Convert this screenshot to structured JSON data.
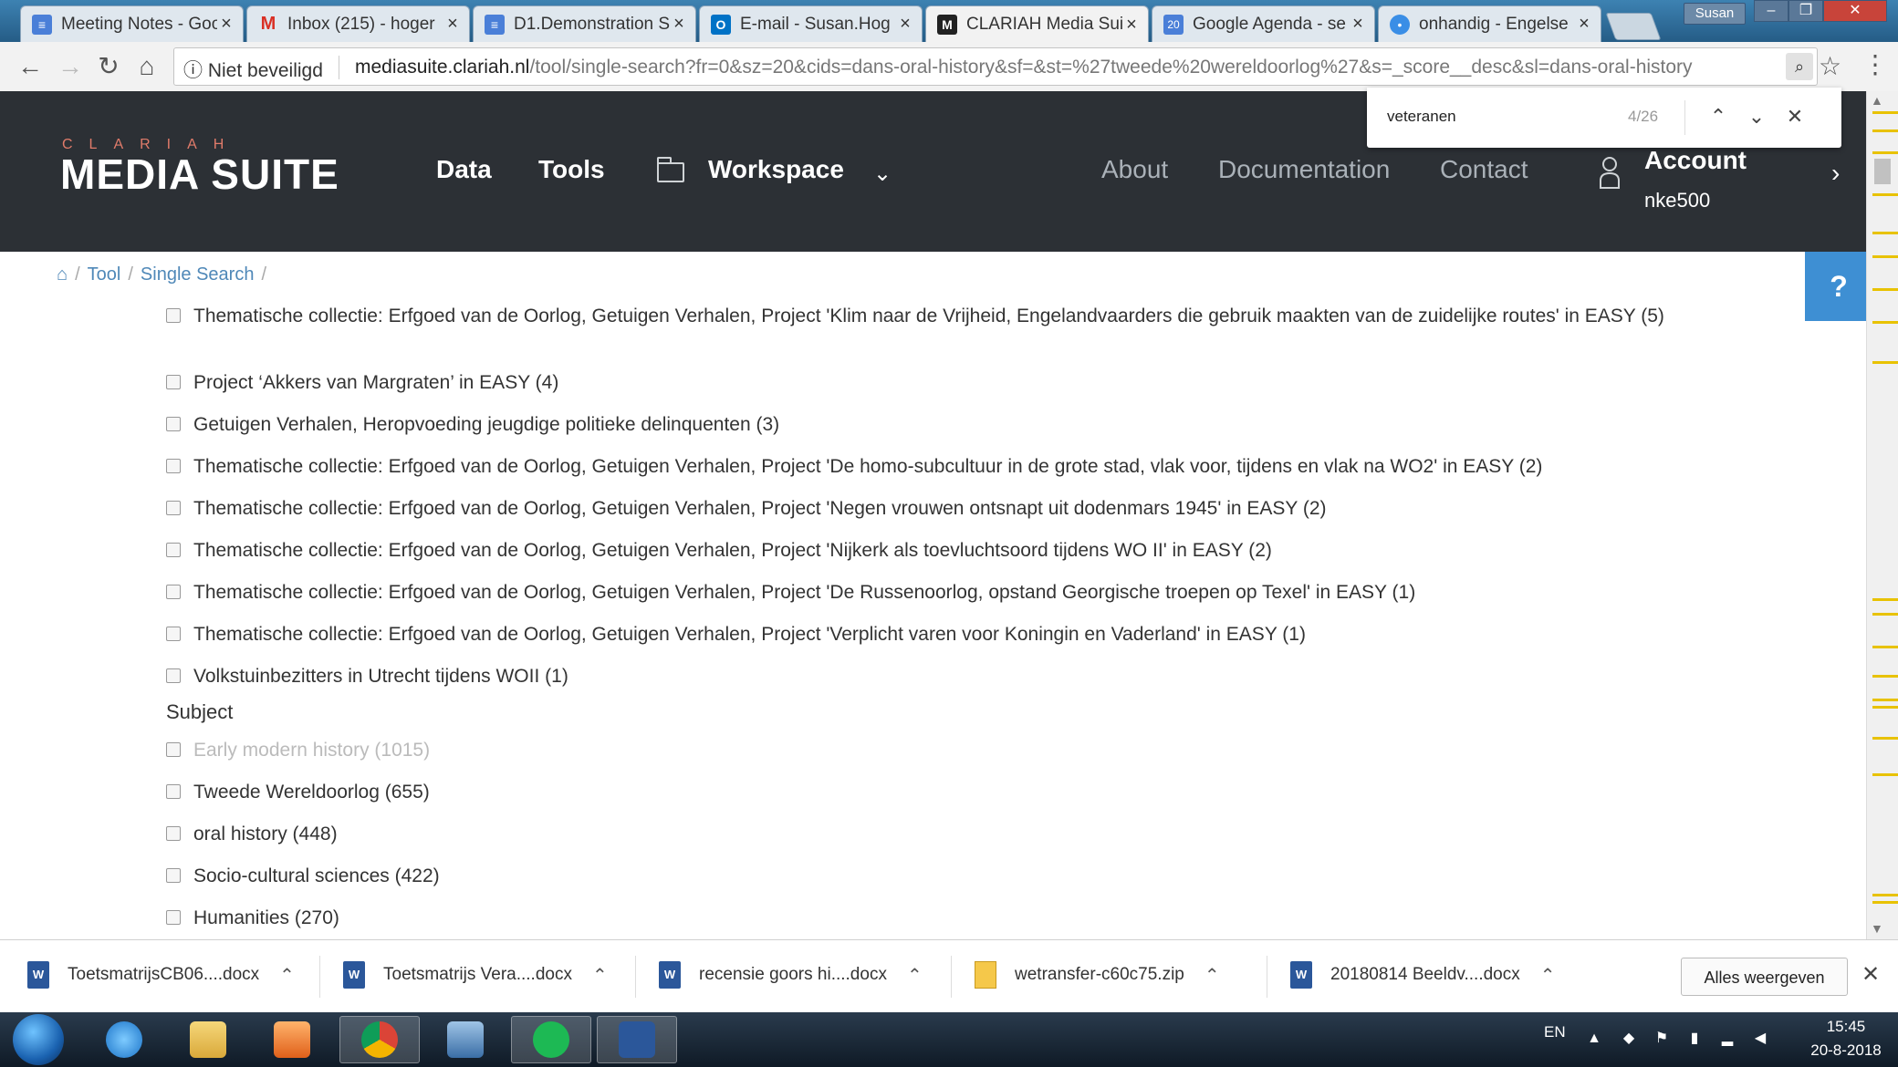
{
  "browser": {
    "tabs": [
      {
        "label": "Meeting Notes - Goo",
        "icon": "docs-icon",
        "color": "#4a7fd8"
      },
      {
        "label": "Inbox (215) - hoger",
        "icon": "gmail-icon",
        "color": "#d93025"
      },
      {
        "label": "D1.Demonstration S",
        "icon": "docs-icon",
        "color": "#4a7fd8"
      },
      {
        "label": "E-mail - Susan.Hog",
        "icon": "outlook-icon",
        "color": "#0072c6"
      },
      {
        "label": "CLARIAH Media Sui",
        "icon": "mediasuite-icon",
        "color": "#222222"
      },
      {
        "label": "Google Agenda - se",
        "icon": "calendar-icon",
        "color": "#4a7fd8"
      },
      {
        "label": "onhandig - Engelse",
        "icon": "chat-icon",
        "color": "#3a8ee6"
      }
    ],
    "user_badge": "Susan",
    "security_label": "Niet beveiligd",
    "url_domain": "mediasuite.clariah.nl",
    "url_path": "/tool/single-search?fr=0&sz=20&cids=dans-oral-history&sf=&st=%27tweede%20wereldoorlog%27&s=_score__desc&sl=dans-oral-history"
  },
  "find": {
    "query": "veteranen",
    "count": "4/26"
  },
  "header": {
    "logo_small": "CLARIAH",
    "logo_big": "MEDIA SUITE",
    "nav": {
      "data": "Data",
      "tools": "Tools",
      "workspace": "Workspace",
      "about": "About",
      "documentation": "Documentation",
      "contact": "Contact"
    },
    "account_label": "Account",
    "account_user": "nke500"
  },
  "breadcrumb": {
    "tool": "Tool",
    "single_search": "Single Search"
  },
  "help_label": "?",
  "facets": {
    "collection_items": [
      "Thematische collectie: Erfgoed van de Oorlog, Getuigen Verhalen, Project 'Klim naar de Vrijheid, Engelandvaarders die gebruik maakten van de zuidelijke routes' in EASY (5)",
      "Project ‘Akkers van Margraten’ in EASY (4)",
      "Getuigen Verhalen, Heropvoeding jeugdige politieke delinquenten (3)",
      "Thematische collectie: Erfgoed van de Oorlog, Getuigen Verhalen, Project 'De homo-subcultuur in de grote stad, vlak voor, tijdens en vlak na WO2' in EASY (2)",
      "Thematische collectie: Erfgoed van de Oorlog, Getuigen Verhalen, Project 'Negen vrouwen ontsnapt uit dodenmars 1945' in EASY (2)",
      "Thematische collectie: Erfgoed van de Oorlog, Getuigen Verhalen, Project 'Nijkerk als toevluchtsoord tijdens WO II' in EASY (2)",
      "Thematische collectie: Erfgoed van de Oorlog, Getuigen Verhalen, Project 'De Russenoorlog, opstand Georgische troepen op Texel' in EASY (1)",
      "Thematische collectie: Erfgoed van de Oorlog, Getuigen Verhalen, Project 'Verplicht varen voor Koningin en Vaderland' in EASY (1)",
      "Volkstuinbezitters in Utrecht tijdens WOII (1)"
    ],
    "subject_heading": "Subject",
    "subject_items": [
      "Early modern history (1015)",
      "Tweede Wereldoorlog (655)",
      "oral history (448)",
      "Socio-cultural sciences (422)",
      "Humanities (270)"
    ]
  },
  "downloads": {
    "items": [
      {
        "name": "ToetsmatrijsCB06....docx",
        "type": "docx"
      },
      {
        "name": "Toetsmatrijs Vera....docx",
        "type": "docx"
      },
      {
        "name": "recensie goors hi....docx",
        "type": "docx"
      },
      {
        "name": "wetransfer-c60c75.zip",
        "type": "zip"
      },
      {
        "name": "20180814 Beeldv....docx",
        "type": "docx"
      }
    ],
    "show_all": "Alles weergeven"
  },
  "taskbar": {
    "language": "EN",
    "time": "15:45",
    "date": "20-8-2018"
  },
  "colors": {
    "header_bg": "#2c3035",
    "logo_accent": "#e07b6a",
    "link": "#4f88b8",
    "help_bg": "#3e8fd3",
    "find_marker": "#e8c200"
  }
}
